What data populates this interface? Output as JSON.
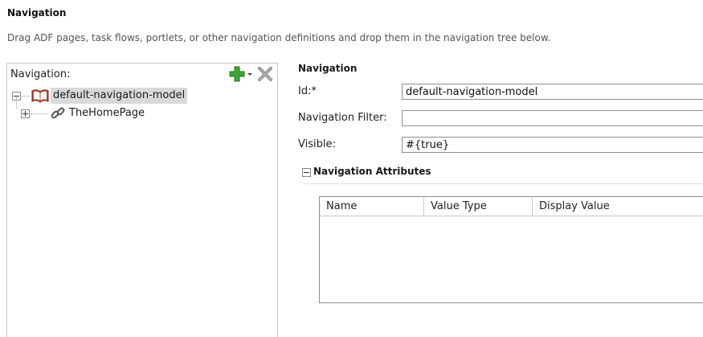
{
  "page": {
    "title": "Navigation",
    "description": "Drag ADF pages, task flows, portlets, or other navigation definitions and drop them in the navigation tree below."
  },
  "tree": {
    "header_label": "Navigation:",
    "add_icon": "add-plus-icon",
    "delete_icon": "delete-x-icon",
    "nodes": [
      {
        "label": "default-navigation-model",
        "icon": "book-icon",
        "expanded": true,
        "selected": true
      },
      {
        "label": "TheHomePage",
        "icon": "link-icon",
        "expanded": false,
        "selected": false
      }
    ]
  },
  "properties": {
    "title": "Navigation",
    "id_label": "Id:*",
    "id_value": "default-navigation-model",
    "filter_label": "Navigation Filter:",
    "filter_value": "",
    "visible_label": "Visible:",
    "visible_value": "#{true}"
  },
  "attributes": {
    "section_label": "Navigation Attributes",
    "columns": [
      "Name",
      "Value Type",
      "Display Value"
    ],
    "rows": []
  },
  "colors": {
    "add_green": "#3aa635",
    "delete_gray": "#8c8c8c",
    "selection": "#d9d9d9",
    "book_red": "#b23b2e"
  }
}
